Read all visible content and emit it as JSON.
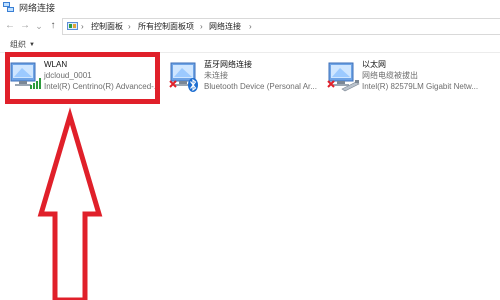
{
  "window": {
    "title": "网络连接"
  },
  "nav": {
    "back_glyph": "←",
    "forward_glyph": "→",
    "dropdown_glyph": "⌄",
    "up_glyph": "↑"
  },
  "address": {
    "breadcrumbs": [
      "控制面板",
      "所有控制面板项",
      "网络连接"
    ],
    "separator": "›"
  },
  "toolbar": {
    "organize_label": "组织",
    "organize_caret": "▼"
  },
  "connections": [
    {
      "name": "WLAN",
      "status": "jdcloud_0001",
      "device": "Intel(R) Centrino(R) Advanced-...",
      "icon": "wifi-adapter-icon",
      "state": "connected"
    },
    {
      "name": "蓝牙网络连接",
      "status": "未连接",
      "device": "Bluetooth Device (Personal Ar...",
      "icon": "bluetooth-adapter-icon",
      "state": "disconnected"
    },
    {
      "name": "以太网",
      "status": "网络电缆被拔出",
      "device": "Intel(R) 82579LM Gigabit Netw...",
      "icon": "ethernet-adapter-icon",
      "state": "unplugged"
    }
  ],
  "annotation": {
    "color": "#e0202a"
  }
}
